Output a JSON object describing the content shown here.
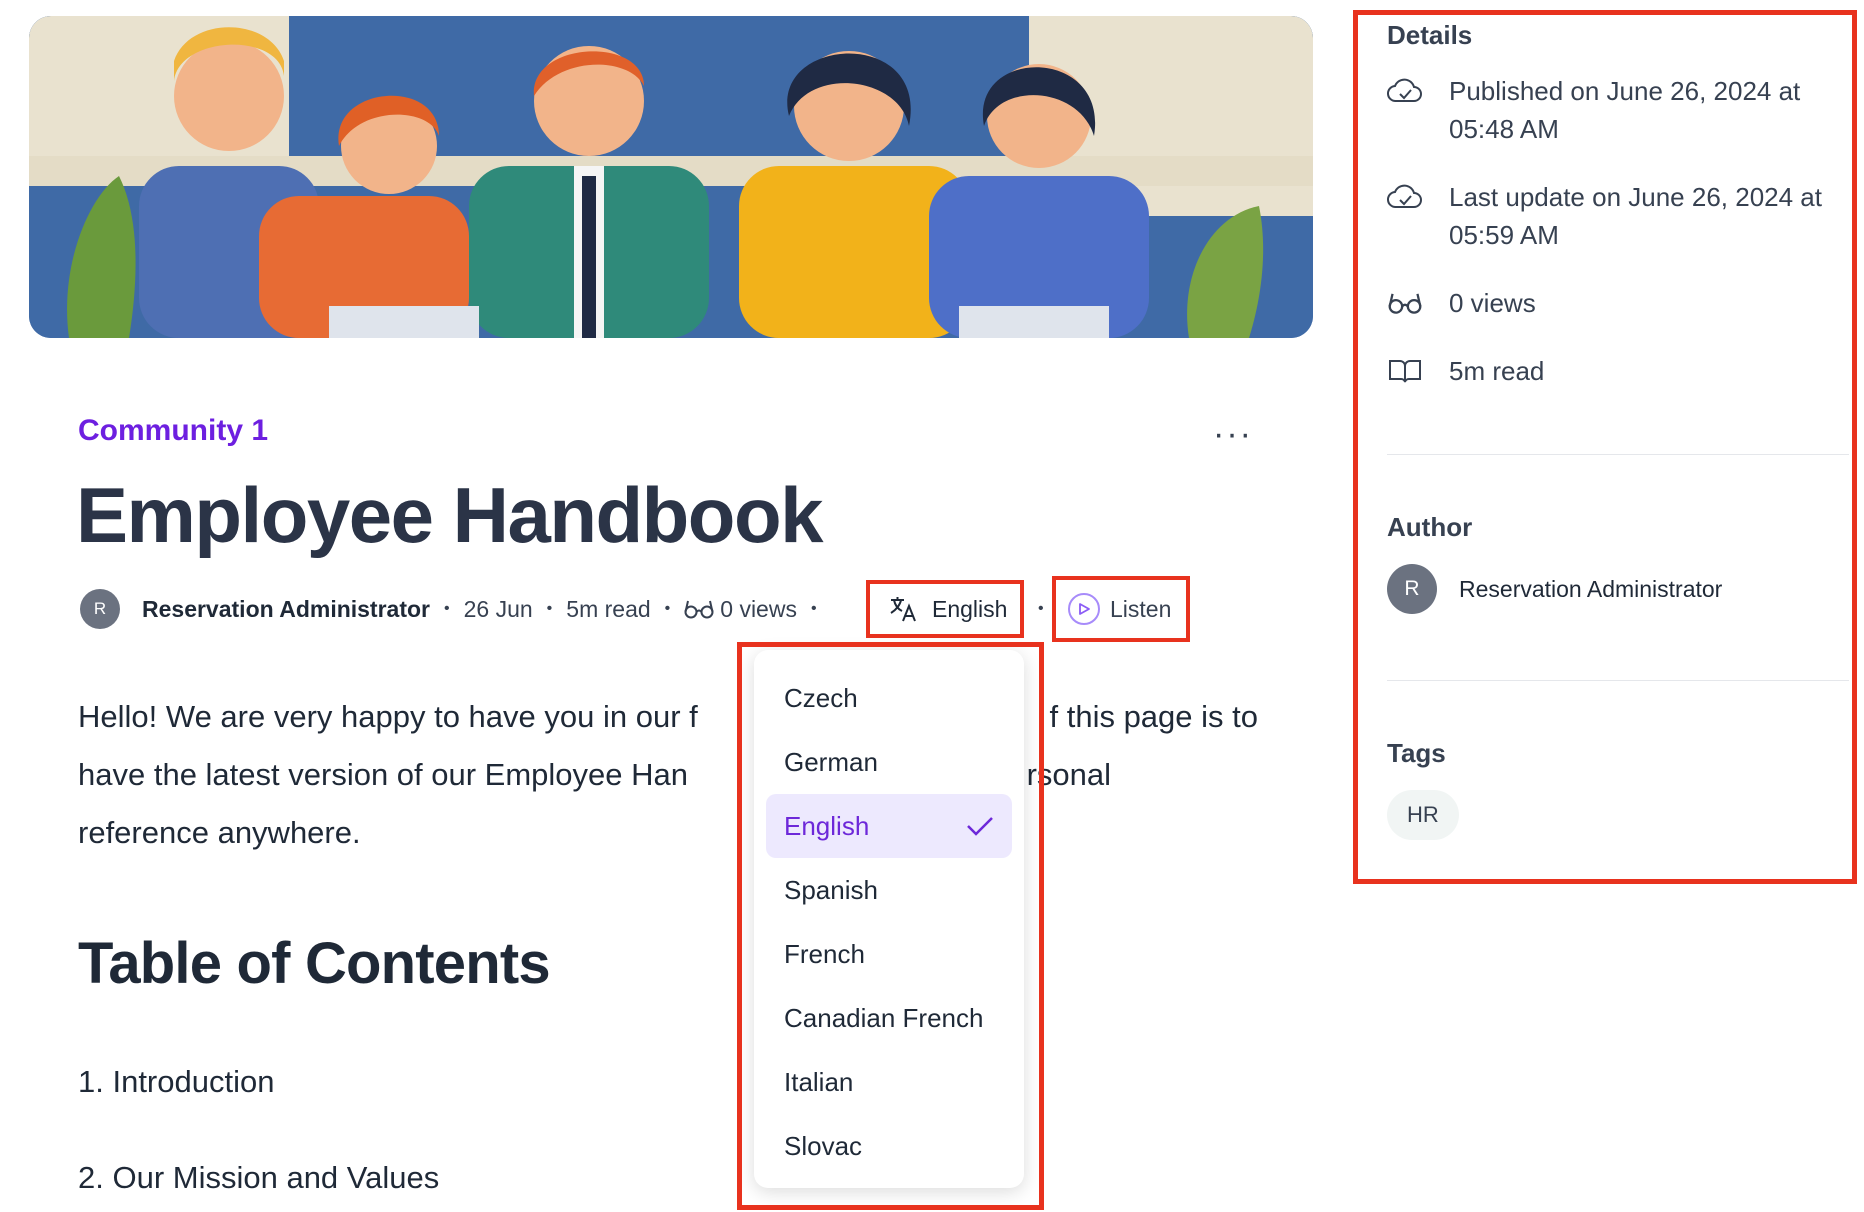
{
  "article": {
    "community": "Community 1",
    "more_label": "···",
    "title": "Employee Handbook",
    "author": "Reservation Administrator",
    "author_initial": "R",
    "date": "26 Jun",
    "read_time": "5m read",
    "views": "0 views",
    "language": "English",
    "listen_label": "Listen",
    "paragraph": "Hello! We are very happy to have you in our f                                       f this page is to have the latest version of our Employee Han                                      rsonal reference anywhere.",
    "paragraph_lines": [
      "Hello! We are very happy to have you in our f",
      "f this page is to",
      "have the latest version of our Employee Han",
      "rsonal",
      "reference anywhere."
    ],
    "toc_heading": "Table of Contents",
    "toc_items": [
      "1. Introduction",
      "2. Our Mission and Values"
    ]
  },
  "language_menu": {
    "items": [
      "Czech",
      "German",
      "English",
      "Spanish",
      "French",
      "Canadian French",
      "Italian",
      "Slovac"
    ],
    "selected": "English"
  },
  "details": {
    "heading": "Details",
    "published": "Published on June 26, 2024 at 05:48 AM",
    "updated": "Last update on June 26, 2024 at 05:59 AM",
    "views": "0 views",
    "read_time": "5m read"
  },
  "author_section": {
    "heading": "Author",
    "initial": "R",
    "name": "Reservation Administrator"
  },
  "tags_section": {
    "heading": "Tags",
    "tags": [
      "HR"
    ]
  },
  "colors": {
    "accent": "#6d1fe0",
    "highlight_border": "#e8321e",
    "selected_bg": "#ede9fe"
  }
}
